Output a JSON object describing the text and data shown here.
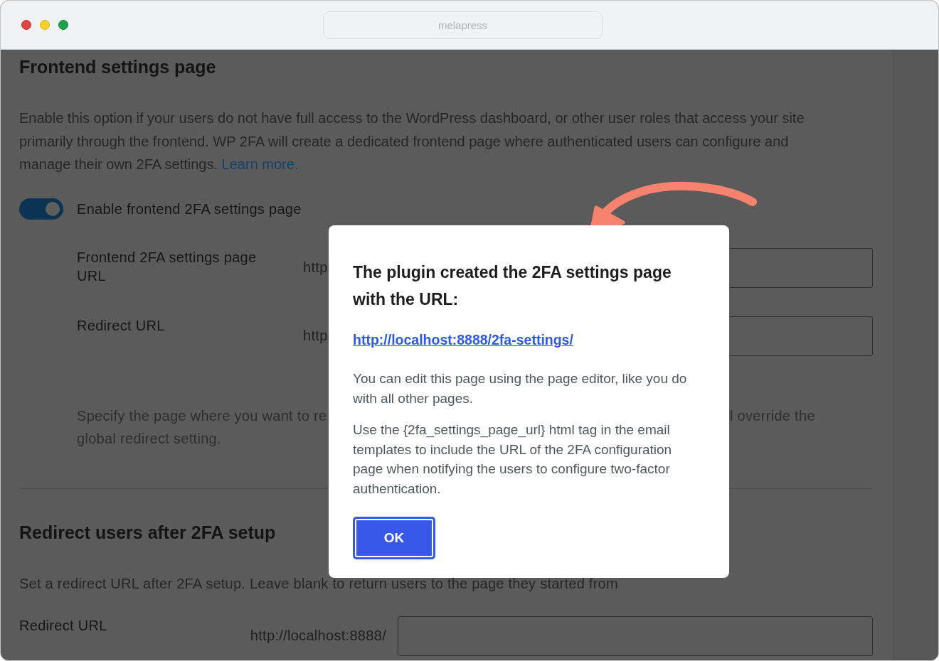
{
  "window": {
    "controls": [
      {
        "kind": "close"
      },
      {
        "kind": "minimize"
      },
      {
        "kind": "maximize"
      }
    ],
    "address": "melapress"
  },
  "frontend_settings": {
    "heading": "Frontend settings page",
    "description": "Enable this option if your users do not have full access to the WordPress dashboard, or other user roles that access your site primarily through the frontend. WP 2FA will create a dedicated frontend page where authenticated users can configure and manage their own 2FA settings.",
    "link": "Learn more.",
    "toggle": {
      "label": "Enable frontend 2FA settings page",
      "on": true
    },
    "fields": [
      {
        "label": "Frontend 2FA settings page URL",
        "prefix": "http"
      },
      {
        "label": "Redirect URL",
        "prefix": "http"
      }
    ],
    "help_lines": [
      [
        "Specify the page where you want to re",
        "l override the"
      ],
      [
        "global redirect setting."
      ]
    ]
  },
  "redirect_section": {
    "heading": "Redirect users after 2FA setup",
    "description": "Set a redirect URL after 2FA setup. Leave blank to return users to the page they started from",
    "field": {
      "label": "Redirect URL",
      "prefix": "http://localhost:8888/"
    }
  },
  "dialog": {
    "title": "The plugin created the 2FA settings page with the URL:",
    "link": "http://localhost:8888/2fa-settings/",
    "paragraphs": [
      "You can edit this page using the page editor, like you do with all other pages.",
      "Use the {2fa_settings_page_url} html tag in the email templates to include the URL of the 2FA configuration page when notifying the users to configure two-factor authentication."
    ],
    "button": "OK"
  }
}
